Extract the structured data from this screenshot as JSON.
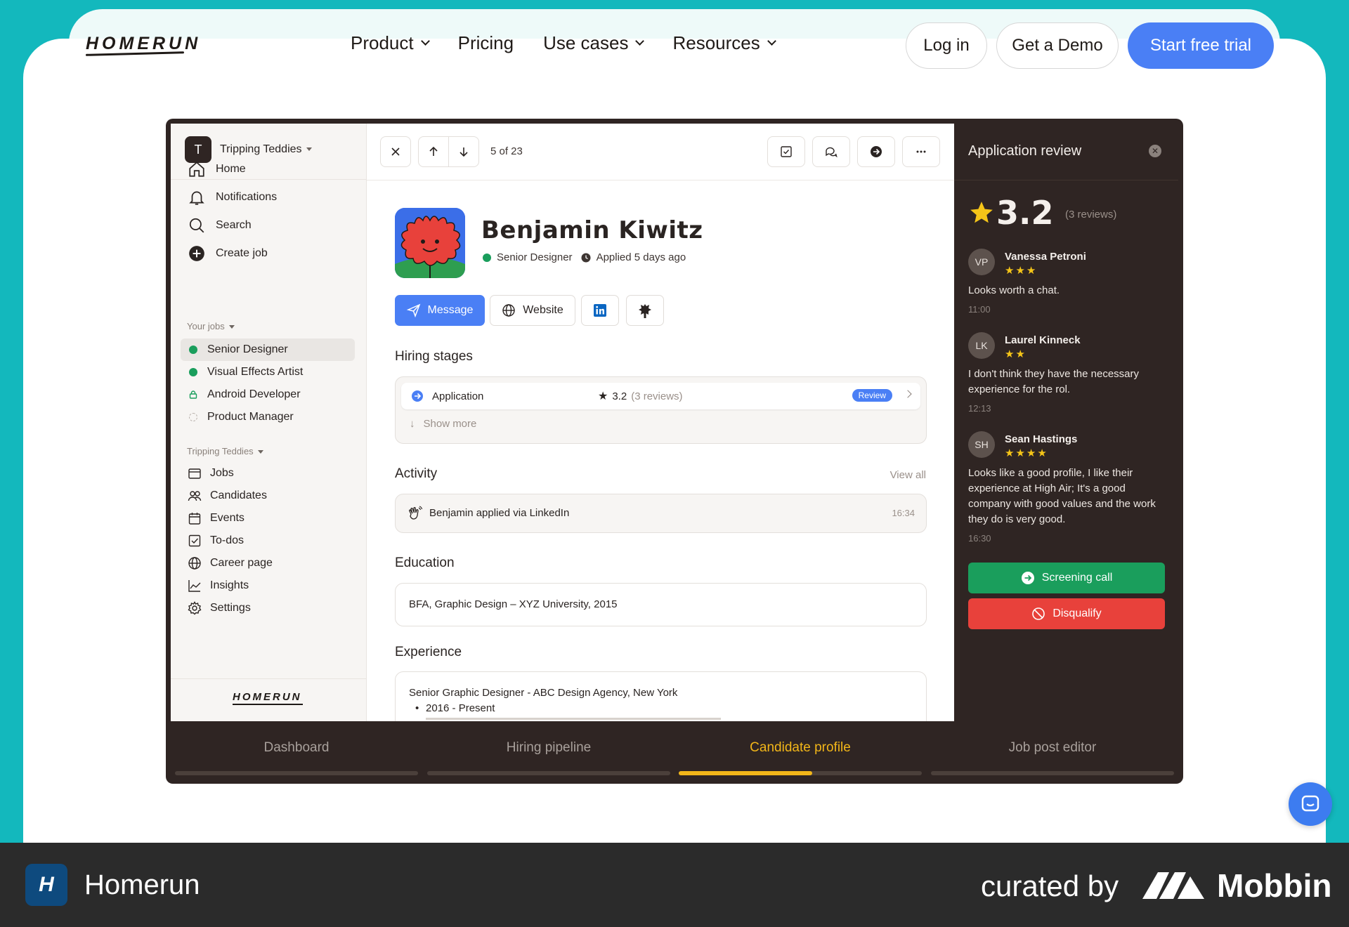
{
  "site": {
    "logo": "HOMERUN",
    "nav": {
      "links": [
        {
          "label": "Product",
          "dropdown": true
        },
        {
          "label": "Pricing",
          "dropdown": false
        },
        {
          "label": "Use cases",
          "dropdown": true
        },
        {
          "label": "Resources",
          "dropdown": true
        }
      ],
      "login": "Log in",
      "demo": "Get a Demo",
      "trial": "Start free trial"
    }
  },
  "app": {
    "workspace": {
      "initial": "T",
      "name": "Tripping Teddies"
    },
    "sidebar": {
      "main_items": [
        {
          "label": "Home",
          "icon": "home-icon"
        },
        {
          "label": "Notifications",
          "icon": "bell-icon"
        },
        {
          "label": "Search",
          "icon": "search-icon"
        },
        {
          "label": "Create job",
          "icon": "plus-circle-icon"
        }
      ],
      "your_jobs_label": "Your jobs",
      "jobs": [
        {
          "label": "Senior Designer",
          "status_color": "#1a9e5c",
          "active": true
        },
        {
          "label": "Visual Effects Artist",
          "status_color": "#1a9e5c",
          "active": false
        },
        {
          "label": "Android Developer",
          "status_color": "#1a9e5c",
          "active": false
        },
        {
          "label": "Product Manager",
          "status_color": "#c9c3be",
          "active": false
        }
      ],
      "company_label": "Tripping Teddies",
      "company_items": [
        {
          "label": "Jobs",
          "icon": "jobs-icon"
        },
        {
          "label": "Candidates",
          "icon": "candidates-icon"
        },
        {
          "label": "Events",
          "icon": "calendar-icon"
        },
        {
          "label": "To-dos",
          "icon": "checkbox-icon"
        },
        {
          "label": "Career page",
          "icon": "globe-icon"
        },
        {
          "label": "Insights",
          "icon": "chart-icon"
        },
        {
          "label": "Settings",
          "icon": "gear-icon"
        }
      ],
      "footer_logo": "HOMERUN"
    },
    "toolbar": {
      "counter": "5 of 23"
    },
    "candidate": {
      "name": "Benjamin Kiwitz",
      "role": "Senior Designer",
      "applied": "Applied 5 days ago",
      "actions": {
        "message": "Message",
        "website": "Website"
      }
    },
    "hiring_stages": {
      "title": "Hiring stages",
      "stage": "Application",
      "rating": "3.2",
      "reviews": "(3 reviews)",
      "badge": "Review",
      "show_more": "Show more"
    },
    "activity": {
      "title": "Activity",
      "view_all": "View all",
      "entry": "Benjamin applied via LinkedIn",
      "time": "16:34"
    },
    "education": {
      "title": "Education",
      "entry": "BFA, Graphic Design – XYZ University, 2015"
    },
    "experience": {
      "title": "Experience",
      "role": "Senior Graphic Designer - ABC Design Agency, New York",
      "period": "2016 - Present"
    },
    "review_panel": {
      "title": "Application review",
      "score": "3.2",
      "reviews_count": "(3 reviews)",
      "reviews": [
        {
          "initials": "VP",
          "name": "Vanessa Petroni",
          "stars": "★★★",
          "text": "Looks worth a chat.",
          "time": "11:00"
        },
        {
          "initials": "LK",
          "name": "Laurel Kinneck",
          "stars": "★★",
          "text": "I don't think they have the necessary experience for the rol.",
          "time": "12:13"
        },
        {
          "initials": "SH",
          "name": "Sean Hastings",
          "stars": "★★★★",
          "text": "Looks like a good profile, I like their experience at High Air; It's a good company with good values and the work they do is very good.",
          "time": "16:30"
        }
      ],
      "screening": "Screening call",
      "disqualify": "Disqualify"
    }
  },
  "tabs": [
    {
      "label": "Dashboard",
      "active": false,
      "progress": 0
    },
    {
      "label": "Hiring pipeline",
      "active": false,
      "progress": 0
    },
    {
      "label": "Candidate profile",
      "active": true,
      "progress": 0.55
    },
    {
      "label": "Job post editor",
      "active": false,
      "progress": 0
    }
  ],
  "footer": {
    "app_name": "Homerun",
    "curated": "curated by",
    "brand": "Mobbin"
  },
  "colors": {
    "teal": "#13b8bd",
    "accent_blue": "#4a7ff5",
    "green": "#1a9e5c",
    "red": "#e8413b",
    "tab_active": "#f2b619"
  }
}
